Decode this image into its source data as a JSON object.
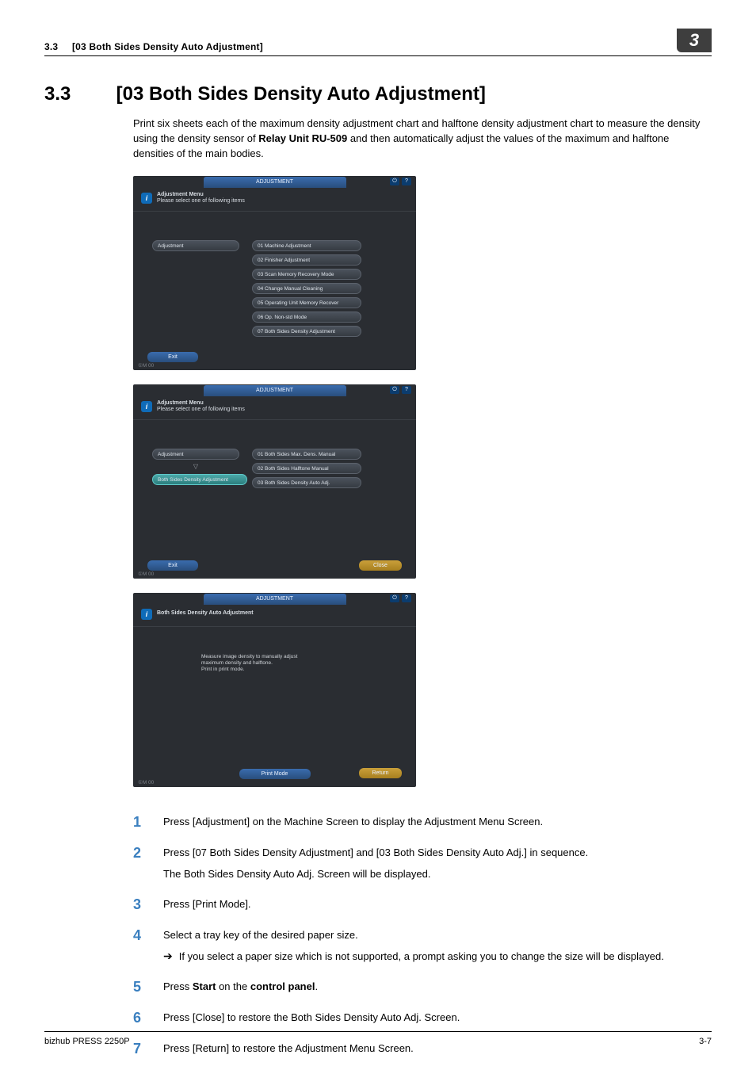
{
  "header": {
    "section_no": "3.3",
    "section_title": "[03 Both Sides Density Auto Adjustment]",
    "chip": "3"
  },
  "title": {
    "no": "3.3",
    "text": "[03 Both Sides Density Auto Adjustment]"
  },
  "intro": "Print six sheets each of the maximum density adjustment chart and halftone density adjustment chart to measure the density using the density sensor of Relay Unit RU-509 and then automatically adjust the values of the maximum and halftone densities of the main bodies.",
  "intro_bold": "Relay Unit RU-509",
  "panels": {
    "tab_label": "ADJUSTMENT",
    "corner_power": "⏻",
    "corner_help": "?",
    "info_title": "Adjustment Menu",
    "info_sub": "Please select one of following items",
    "mem": "①M 00",
    "p1": {
      "left": [
        "Adjustment"
      ],
      "right": [
        "01 Machine Adjustment",
        "02 Finisher Adjustment",
        "03 Scan Memory Recovery Mode",
        "04 Change Manual Cleaning",
        "05 Operating Unit Memory Recover",
        "06 Op. Non-std Mode",
        "07 Both Sides Density Adjustment"
      ],
      "exit": "Exit"
    },
    "p2": {
      "left_top": "Adjustment",
      "left_sel": "Both Sides Density Adjustment",
      "right": [
        "01 Both Sides Max. Dens. Manual",
        "02 Both Sides Halftone Manual",
        "03 Both Sides Density Auto Adj."
      ],
      "exit": "Exit",
      "close": "Close"
    },
    "p3": {
      "info_title": "Both Sides Density Auto Adjustment",
      "msg": "Measure image density to manually adjust\nmaximum density and halftone.\nPrint in print mode.",
      "print": "Print Mode",
      "return": "Return"
    }
  },
  "steps": [
    {
      "n": "1",
      "text": "Press [Adjustment] on the Machine Screen to display the Adjustment Menu Screen."
    },
    {
      "n": "2",
      "text": "Press [07 Both Sides Density Adjustment] and [03 Both Sides Density Auto Adj.] in sequence.",
      "sub": "The Both Sides Density Auto Adj. Screen will be displayed."
    },
    {
      "n": "3",
      "text": "Press [Print Mode]."
    },
    {
      "n": "4",
      "text": "Select a tray key of the desired paper size.",
      "arrow": "If you select a paper size which is not supported, a prompt asking you to change the size will be displayed."
    },
    {
      "n": "5",
      "html": "Press <b>Start</b> on the <b>control panel</b>."
    },
    {
      "n": "6",
      "text": "Press [Close] to restore the Both Sides Density Auto Adj. Screen."
    },
    {
      "n": "7",
      "text": "Press [Return] to restore the Adjustment Menu Screen."
    }
  ],
  "footer": {
    "left": "bizhub PRESS 2250P",
    "right": "3-7"
  }
}
